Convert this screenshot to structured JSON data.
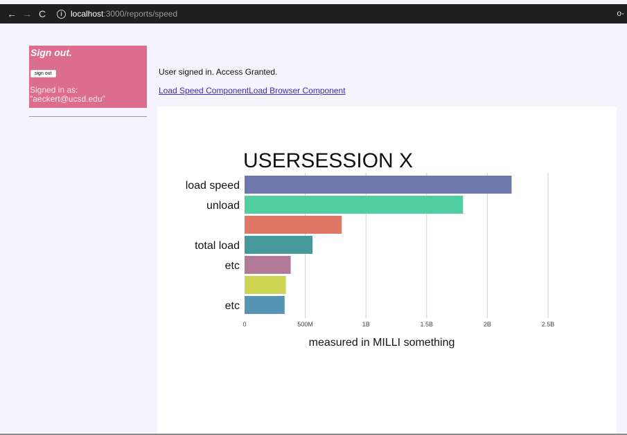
{
  "browser": {
    "back_icon": "←",
    "forward_icon": "→",
    "reload_icon": "C",
    "url_host": "localhost",
    "url_rest": ":3000/reports/speed",
    "key_icon": "o-"
  },
  "sidebar": {
    "title": "Sign out.",
    "button_label": "sign out",
    "signed_in_label": "Signed in as:",
    "signed_in_user": "\"aeckert@ucsd.edu\""
  },
  "main": {
    "status": "User signed in. Access Granted.",
    "links": [
      {
        "label": "Load Speed Component"
      },
      {
        "label": "Load Browser Component"
      }
    ]
  },
  "chart_data": {
    "type": "bar",
    "orientation": "horizontal",
    "title": "USERSESSION X",
    "xlabel": "measured in MILLI something",
    "ylabel": "",
    "categories": [
      "load speed",
      "unload",
      "",
      "total load",
      "etc",
      "",
      "etc"
    ],
    "tick_labels": [
      "load speed",
      "unload",
      "total load",
      "etc",
      "etc"
    ],
    "values": [
      2200000000,
      1800000000,
      800000000,
      560000000,
      380000000,
      340000000,
      330000000
    ],
    "colors": [
      "#6f78ad",
      "#4fcfa1",
      "#e07766",
      "#479a9b",
      "#b07a98",
      "#cdd451",
      "#5594b2"
    ],
    "xlim": [
      0,
      2500000000
    ],
    "xticks": [
      0,
      500000000,
      1000000000,
      1500000000,
      2000000000,
      2500000000
    ],
    "xtick_labels": [
      "0",
      "500M",
      "1B",
      "1.5B",
      "2B",
      "2.5B"
    ],
    "grid": true
  }
}
